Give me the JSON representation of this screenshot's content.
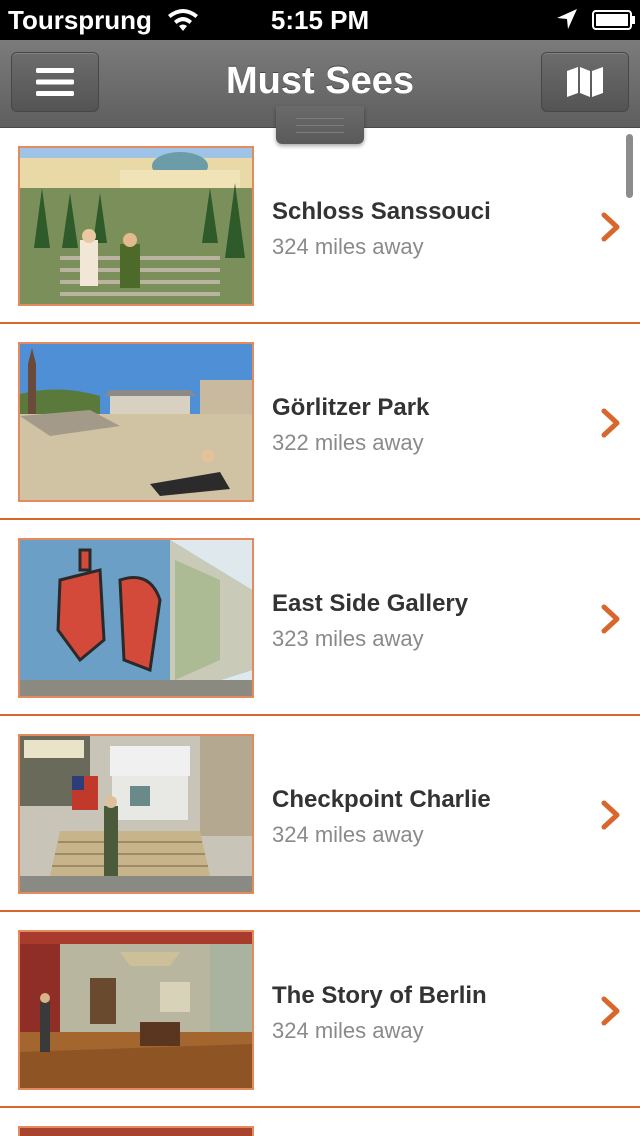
{
  "status_bar": {
    "carrier": "Toursprung",
    "time": "5:15 PM",
    "icons": [
      "wifi-icon",
      "location-arrow-icon",
      "battery-icon"
    ]
  },
  "nav": {
    "title": "Must Sees",
    "left_icon": "hamburger-menu-icon",
    "right_icon": "map-icon"
  },
  "colors": {
    "accent": "#d9662c",
    "nav_bg": "#6b6b6b",
    "title_text": "#333333",
    "subtitle_text": "#8a8a8a"
  },
  "items": [
    {
      "title": "Schloss Sanssouci",
      "distance": "324 miles away"
    },
    {
      "title": "Görlitzer Park",
      "distance": "322 miles away"
    },
    {
      "title": "East Side Gallery",
      "distance": "323 miles away"
    },
    {
      "title": "Checkpoint Charlie",
      "distance": "324 miles away"
    },
    {
      "title": "The Story of Berlin",
      "distance": "324 miles away"
    }
  ]
}
